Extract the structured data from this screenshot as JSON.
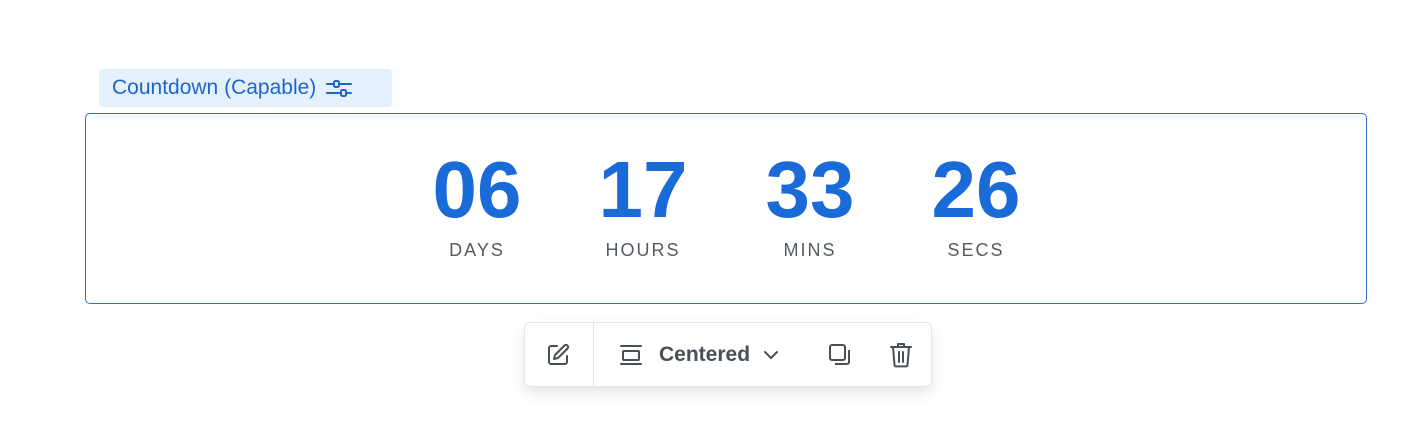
{
  "block": {
    "tag_label": "Countdown (Capable)",
    "tag_icon": "sliders-icon"
  },
  "countdown": {
    "units": [
      {
        "value": "06",
        "label": "DAYS"
      },
      {
        "value": "17",
        "label": "HOURS"
      },
      {
        "value": "33",
        "label": "MINS"
      },
      {
        "value": "26",
        "label": "SECS"
      }
    ]
  },
  "toolbar": {
    "edit_icon": "edit-icon",
    "align_icon": "align-center-icon",
    "alignment_value": "Centered",
    "chevron_icon": "chevron-down-icon",
    "duplicate_icon": "duplicate-icon",
    "delete_icon": "trash-icon"
  },
  "colors": {
    "accent": "#1a6ad8",
    "tag_background": "#e5f0fd",
    "border": "#2f6fc8",
    "label_text": "#555b63"
  }
}
